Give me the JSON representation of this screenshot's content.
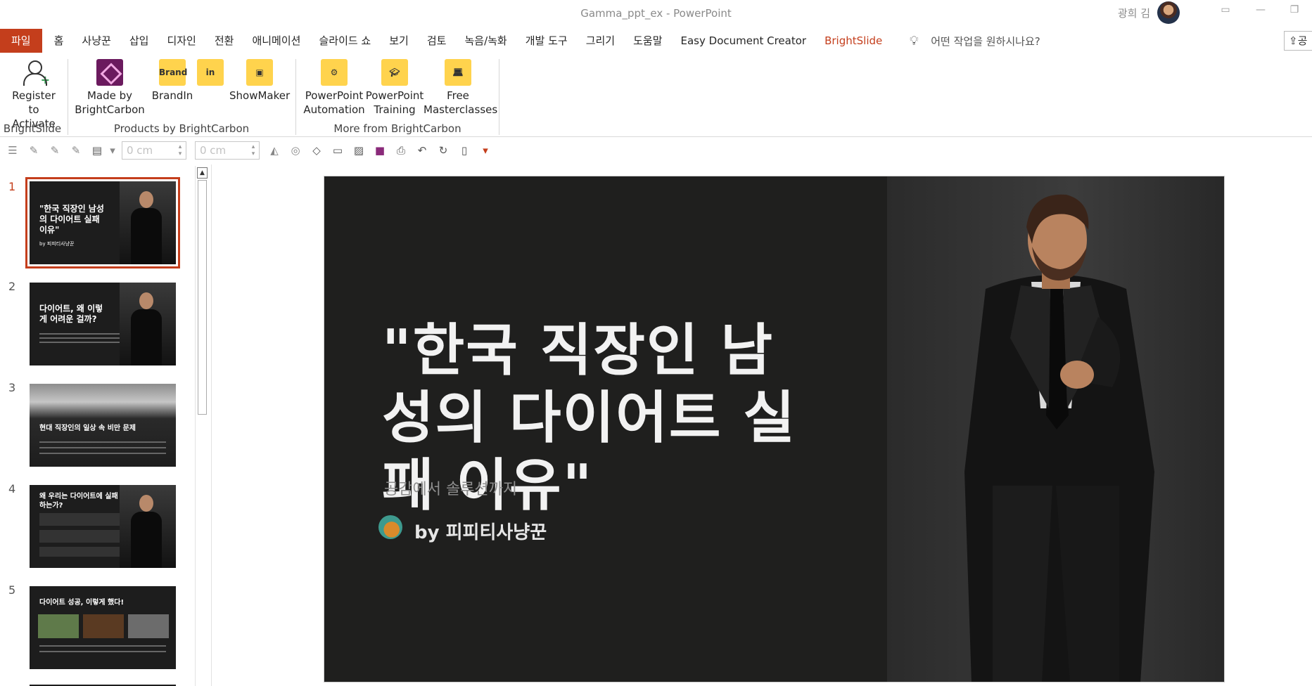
{
  "window": {
    "title": "Gamma_ppt_ex  -  PowerPoint",
    "user_name": "광희 김"
  },
  "ribbon_tabs": [
    {
      "label": "파일"
    },
    {
      "label": "홈"
    },
    {
      "label": "사냥꾼"
    },
    {
      "label": "삽입"
    },
    {
      "label": "디자인"
    },
    {
      "label": "전환"
    },
    {
      "label": "애니메이션"
    },
    {
      "label": "슬라이드 쇼"
    },
    {
      "label": "보기"
    },
    {
      "label": "검토"
    },
    {
      "label": "녹음/녹화"
    },
    {
      "label": "개발 도구"
    },
    {
      "label": "그리기"
    },
    {
      "label": "도움말"
    },
    {
      "label": "Easy Document Creator"
    },
    {
      "label": "BrightSlide"
    }
  ],
  "tell_me": "어떤 작업을 원하시나요?",
  "share_label": "공",
  "ribbon": {
    "register": "Register\nto Activate",
    "made_by": "Made by\nBrightCarbon",
    "brandin": "BrandIn",
    "brandin_icon_text": "Brand",
    "linkedin_icon_text": "in",
    "showmaker": "ShowMaker",
    "pp_automation": "PowerPoint\nAutomation",
    "pp_training": "PowerPoint\nTraining",
    "free_masterclasses": "Free\nMasterclasses",
    "group_brightslide": "BrightSlide",
    "group_products": "Products by BrightCarbon",
    "group_more": "More from BrightCarbon"
  },
  "quick_toolbar": {
    "width_field": "0 cm",
    "height_field": "0 cm"
  },
  "thumbnails": [
    {
      "num": "1",
      "title": "\"한국 직장인 남성\n의 다이어트 실패\n이유\"",
      "author": "by 피피티사냥꾼"
    },
    {
      "num": "2",
      "title": "다이어트, 왜 이렇\n게 어려운 걸까?"
    },
    {
      "num": "3",
      "title": "현대 직장인의 일상 속 비만 문제"
    },
    {
      "num": "4",
      "title": "왜 우리는 다이어트에 실패\n하는가?"
    },
    {
      "num": "5",
      "title": "다이어트 성공, 이렇게 했다!"
    }
  ],
  "slide": {
    "title": "\"한국 직장인 남성의 다이어트 실패 이유\"",
    "subtitle": "공감에서 솔루션까지",
    "author": "by 피피티사냥꾼"
  }
}
